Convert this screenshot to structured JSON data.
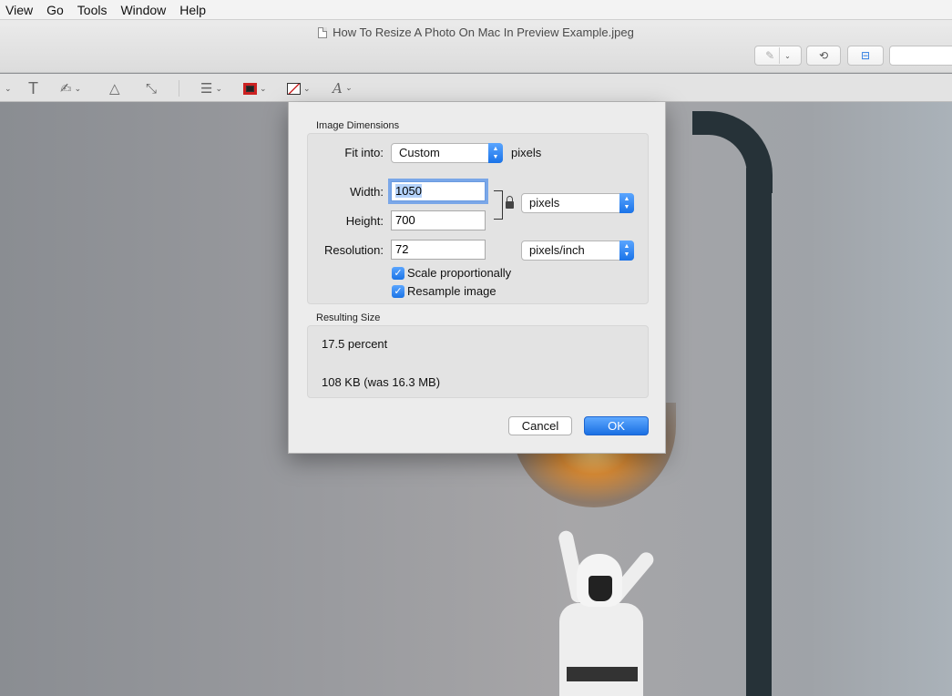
{
  "menubar": {
    "items": [
      "View",
      "Go",
      "Tools",
      "Window",
      "Help"
    ]
  },
  "window": {
    "title": "How To Resize A Photo On Mac In Preview Example.jpeg"
  },
  "toolbar": {
    "icons": [
      "pen-annotate-icon",
      "rotate-icon",
      "toolbox-icon",
      "search-field"
    ],
    "markup_icons": [
      "text-tool-icon",
      "signature-tool-icon",
      "adjust-color-icon",
      "adjust-size-icon",
      "line-style-icon",
      "border-color-icon",
      "fill-color-icon",
      "text-style-icon"
    ]
  },
  "dialog": {
    "dimensions_label": "Image Dimensions",
    "fit_into_label": "Fit into:",
    "fit_into_value": "Custom",
    "fit_into_unit": "pixels",
    "width_label": "Width:",
    "width_value": "1050",
    "height_label": "Height:",
    "height_value": "700",
    "size_unit_value": "pixels",
    "resolution_label": "Resolution:",
    "resolution_value": "72",
    "resolution_unit_value": "pixels/inch",
    "scale_label": "Scale proportionally",
    "scale_checked": true,
    "resample_label": "Resample image",
    "resample_checked": true,
    "result_label": "Resulting Size",
    "result_percent": "17.5 percent",
    "result_size": "108 KB (was 16.3 MB)",
    "cancel_label": "Cancel",
    "ok_label": "OK"
  },
  "colors": {
    "accent": "#1a73e8",
    "focus_ring": "#7aa7e8",
    "border_color_swatch": "#cc2222"
  }
}
